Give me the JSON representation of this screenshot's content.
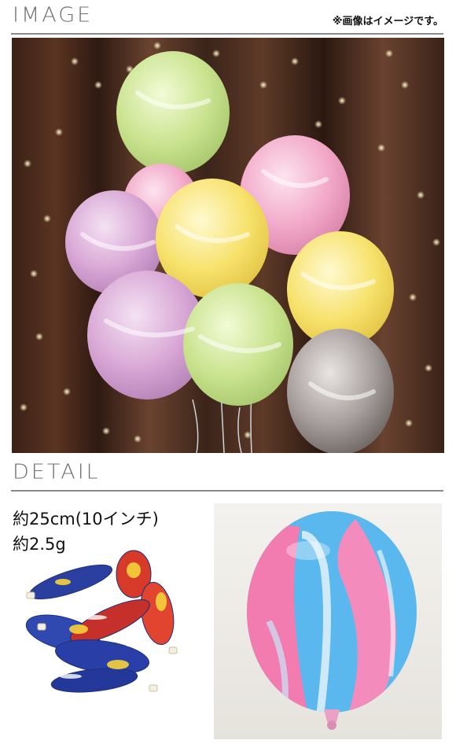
{
  "header": {
    "image_title": "IMAGE",
    "note": "※画像はイメージです。"
  },
  "detail": {
    "title": "DETAIL",
    "size": "約25cm(10インチ)",
    "weight": "約2.5g"
  },
  "images": {
    "main": "marble-balloons-bouquet-photo",
    "pack": "deflated-balloons-photo",
    "closeup": "single-marble-balloon-photo"
  },
  "colors": {
    "title_text": "#6f6f6f",
    "rule": "#8a8a8a"
  }
}
